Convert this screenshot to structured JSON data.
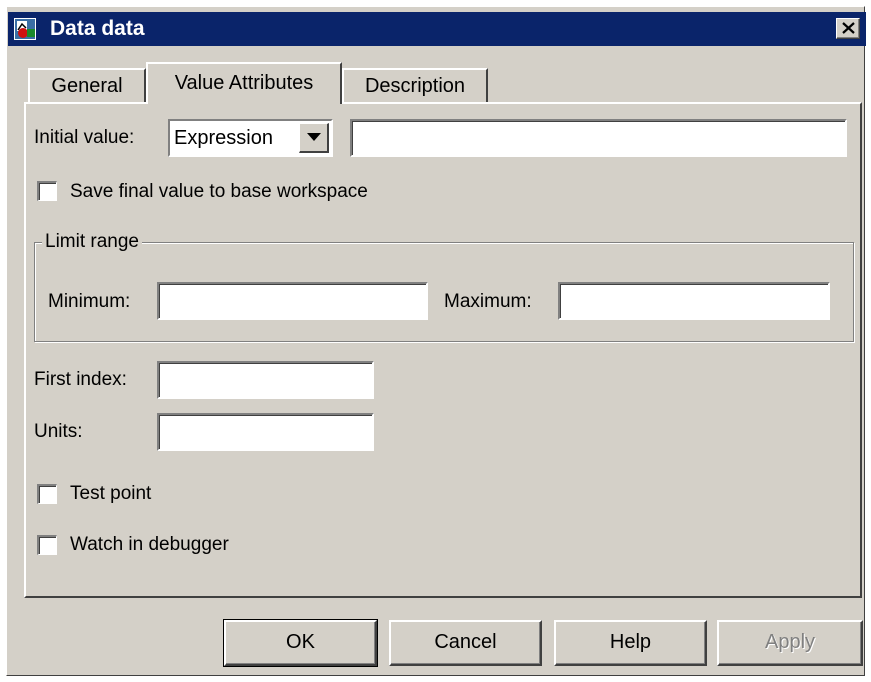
{
  "window": {
    "title": "Data data",
    "app_icon": "simulink-data-icon",
    "close_icon": "close-icon"
  },
  "tabs": [
    {
      "label": "General",
      "selected": false
    },
    {
      "label": "Value Attributes",
      "selected": true
    },
    {
      "label": "Description",
      "selected": false
    }
  ],
  "initial_value": {
    "label": "Initial value:",
    "mode_selected": "Expression",
    "expression_value": ""
  },
  "save_final": {
    "label": "Save final value to base workspace",
    "checked": false
  },
  "limit_range": {
    "title": "Limit range",
    "minimum_label": "Minimum:",
    "minimum_value": "",
    "maximum_label": "Maximum:",
    "maximum_value": ""
  },
  "first_index": {
    "label": "First index:",
    "value": ""
  },
  "units": {
    "label": "Units:",
    "value": ""
  },
  "test_point": {
    "label": "Test point",
    "checked": false
  },
  "watch_debugger": {
    "label": "Watch in debugger",
    "checked": false
  },
  "buttons": {
    "ok": "OK",
    "cancel": "Cancel",
    "help": "Help",
    "apply": "Apply",
    "apply_enabled": false
  },
  "colors": {
    "titlebar": "#0a246a",
    "face": "#d4d0c8",
    "disabled_text": "#808080"
  }
}
